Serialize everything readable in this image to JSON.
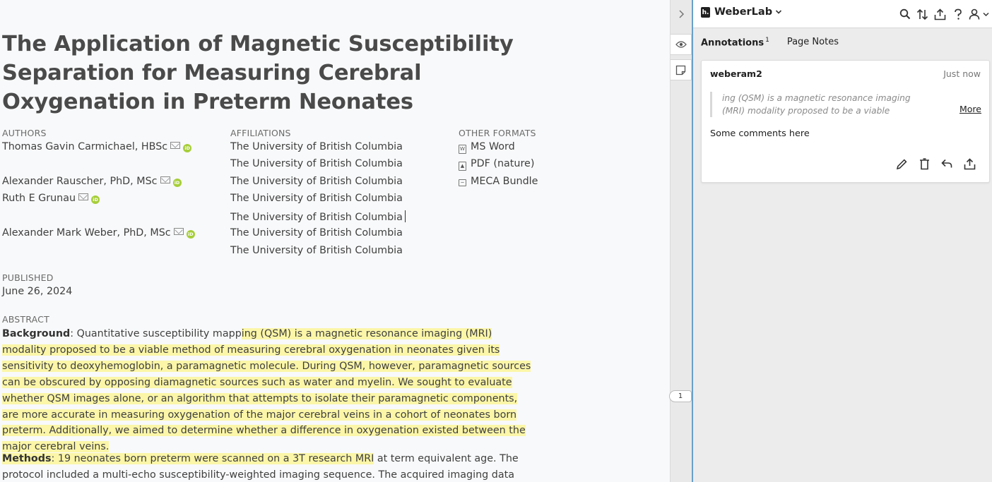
{
  "article": {
    "title": "The Application of Magnetic Susceptibility Separation for Measuring Cerebral Oxygenation in Preterm Neonates",
    "authors_label": "AUTHORS",
    "authors": [
      "Thomas Gavin Carmichael, HBSc",
      "Alexander Rauscher, PhD, MSc",
      "Ruth E Grunau",
      "Alexander Mark Weber, PhD, MSc"
    ],
    "affiliations_label": "AFFILIATIONS",
    "affiliations": [
      "The University of British Columbia",
      "The University of British Columbia",
      "The University of British Columbia",
      "The University of British Columbia",
      "The University of British Columbia",
      "The University of British Columbia",
      "The University of British Columbia"
    ],
    "formats_label": "OTHER FORMATS",
    "formats": [
      "MS Word",
      "PDF (nature)",
      "MECA Bundle"
    ],
    "published_label": "PUBLISHED",
    "published_date": "June 26, 2024",
    "abstract_label": "ABSTRACT",
    "background_label": "Background",
    "background_pre": ": Quantitative susceptibility mapp",
    "background_highlight": "ing (QSM) is a magnetic resonance imaging (MRI) modality proposed to be a viable method of measuring cerebral oxygenation in neonates given its sensitivity to deoxyhemoglobin, a paramagnetic molecule. During QSM, however, paramagnetic sources can be obscured by opposing diamagnetic sources such as water and myelin. We sought to evaluate whether QSM images alone, or an algorithm that attempts to isolate their paramagnetic components, are more accurate in measuring oxygenation of the major cerebral veins in a cohort of neonates born preterm. Additionally, we aimed to determine whether a difference in oxygenation existed between the major cerebral veins.",
    "methods_label": "Methods",
    "methods_highlight": ": 19 neonates born preterm were scanned on a 3T research MRI",
    "methods_rest": " at term equivalent age. The protocol included a multi-echo susceptibility-weighted imaging sequence. The acquired imaging data were processed as QSM images to"
  },
  "toolbar": {
    "collapse_icon": "chevron-right-icon",
    "bucket_count": "1"
  },
  "panel": {
    "group_name": "WeberLab",
    "tabs": [
      {
        "label": "Annotations",
        "count": "1"
      },
      {
        "label": "Page Notes"
      }
    ],
    "annotation": {
      "user": "weberam2",
      "time": "Just now",
      "quote": "ing (QSM) is a magnetic resonance imaging (MRI) modality proposed to be a viable method of measuring cerebral oxygenation",
      "more_label": "More",
      "comment": "Some comments here"
    }
  },
  "colors": {
    "highlight": "#fbf6a8",
    "orcid": "#a6ce39",
    "panel_bg": "#ececec",
    "accent_border": "#6aa0c8"
  }
}
